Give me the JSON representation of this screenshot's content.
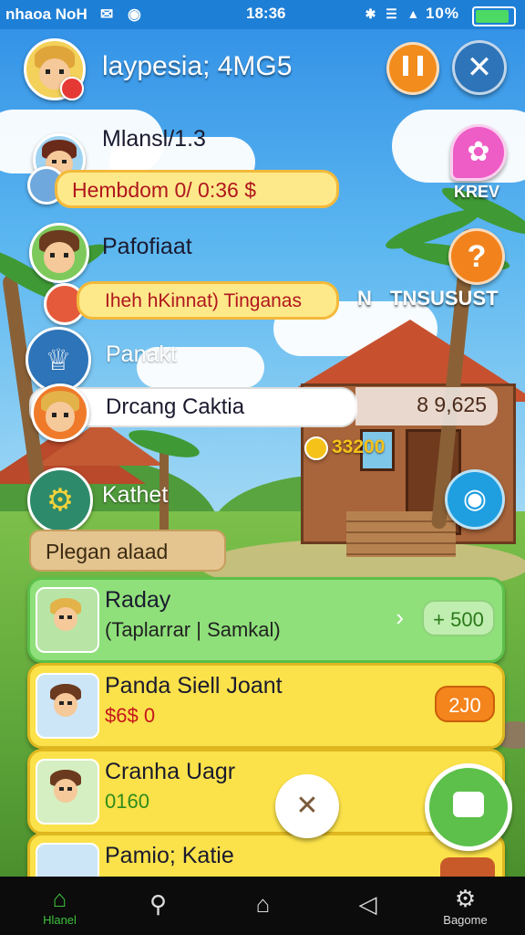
{
  "status_bar": {
    "carrier": "nhaoa NoH",
    "time": "18:36",
    "battery_text": "10%",
    "icons": [
      "notification-icon",
      "bluetooth-icon",
      "wifi-icon",
      "signal-icon",
      "battery-icon"
    ]
  },
  "header": {
    "title": "laypesia; 4MG5",
    "buttons": [
      {
        "name": "pause-button",
        "icon": "pause-icon",
        "color": "#f28c1c"
      },
      {
        "name": "close-button",
        "icon": "close-icon",
        "color": "#2e74b8"
      }
    ]
  },
  "players": [
    {
      "name": "Mlansl/1.3",
      "detail": "Hembdom 0/ 0:36 $"
    },
    {
      "name": "Pafofiaat",
      "detail": "Iheh hKinnat) Tinganas"
    },
    {
      "name": "Panakt"
    },
    {
      "name": "",
      "detail": "Drcang Caktia",
      "value": "8 9,625"
    },
    {
      "name": "Kathet",
      "detail": "Plegan alaad"
    }
  ],
  "side_buttons": [
    {
      "label": "KREV",
      "icon": "flower-icon",
      "color": "#ee5cc6"
    },
    {
      "label": "TNSUSUST",
      "icon": "question-icon",
      "color": "#f2831c",
      "prefix": "N"
    },
    {
      "label": "",
      "icon": "camera-icon",
      "color": "#1f9ee0"
    }
  ],
  "coin_amount": "33200",
  "quests": [
    {
      "title": "Raday",
      "subtitle": "(Taplarrar | Samkal)",
      "badge": "+ 500",
      "style": "green"
    },
    {
      "title": "Panda Siell Joant",
      "subtitle": "$6$ 0",
      "badge": "2J0",
      "style": "yellow"
    },
    {
      "title": "Cranha Uagr",
      "subtitle": "0160",
      "badge": "",
      "style": "yellow"
    },
    {
      "title": "Pamio; Katie",
      "subtitle": "",
      "badge": "",
      "style": "yellow"
    }
  ],
  "fab": {
    "icon": "map-icon",
    "color": "#5cc04a"
  },
  "dismiss": {
    "icon": "close-icon"
  },
  "nav": [
    {
      "label": "Hlanel",
      "icon": "home-icon",
      "active": true
    },
    {
      "label": "",
      "icon": "search-icon"
    },
    {
      "label": "",
      "icon": "home-outline-icon"
    },
    {
      "label": "",
      "icon": "back-icon"
    },
    {
      "label": "Bagome",
      "icon": "settings-icon"
    }
  ]
}
